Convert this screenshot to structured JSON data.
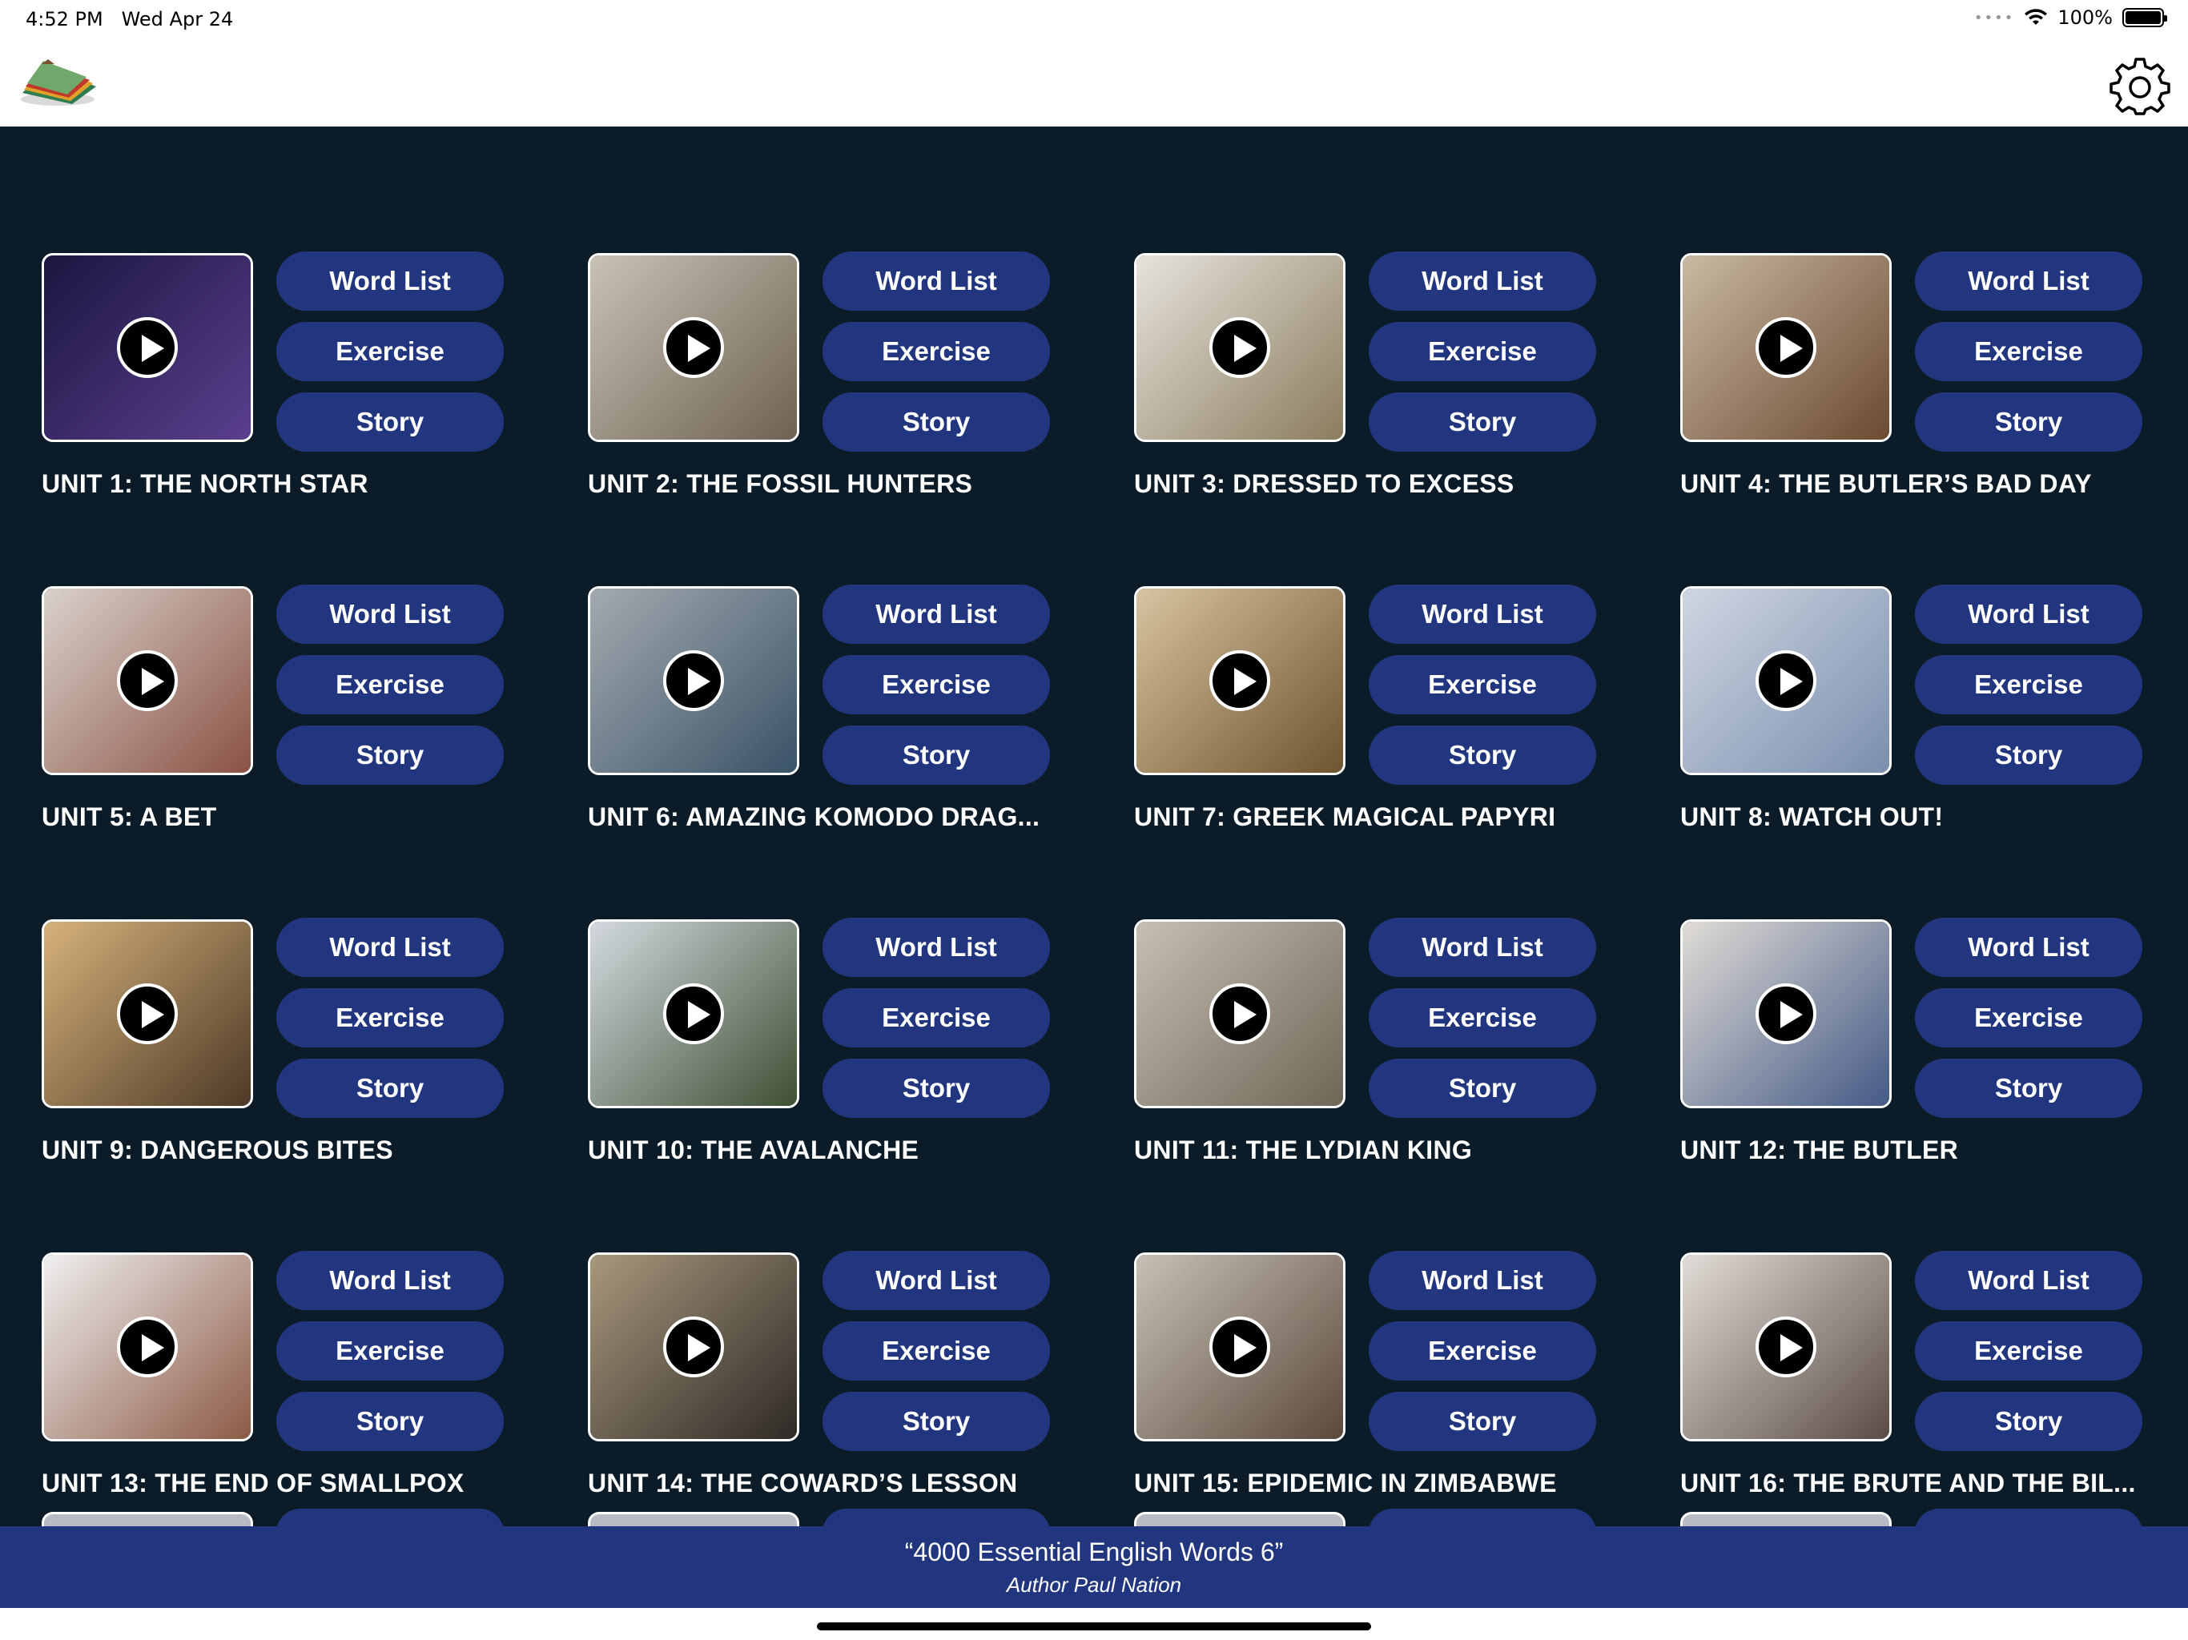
{
  "status": {
    "time": "4:52 PM",
    "date": "Wed Apr 24",
    "battery": "100%"
  },
  "nav": {
    "logo_icon": "flashcards-logo-icon",
    "settings_icon": "gear-icon"
  },
  "buttons": {
    "word_list": "Word List",
    "exercise": "Exercise",
    "story": "Story"
  },
  "units": [
    {
      "title": "UNIT 1: THE NORTH STAR",
      "colors": [
        "#1b1640",
        "#5a3f8e"
      ]
    },
    {
      "title": "UNIT 2: THE FOSSIL HUNTERS",
      "colors": [
        "#c8c2b5",
        "#6e6253"
      ]
    },
    {
      "title": "UNIT 3: DRESSED TO EXCESS",
      "colors": [
        "#e6e3dc",
        "#8b7d5e"
      ]
    },
    {
      "title": "UNIT 4: THE BUTLER’S BAD DAY",
      "colors": [
        "#c9b9a3",
        "#6b4a30"
      ]
    },
    {
      "title": "UNIT 5: A BET",
      "colors": [
        "#d9d2cb",
        "#8a5244"
      ]
    },
    {
      "title": "UNIT 6: AMAZING KOMODO DRAG...",
      "colors": [
        "#a3aab0",
        "#3a5367"
      ]
    },
    {
      "title": "UNIT 7: GREEK MAGICAL PAPYRI",
      "colors": [
        "#d8c4a0",
        "#6f5430"
      ]
    },
    {
      "title": "UNIT 8: WATCH OUT!",
      "colors": [
        "#cfd6e1",
        "#7a8fae"
      ]
    },
    {
      "title": "UNIT 9: DANGEROUS BITES",
      "colors": [
        "#d6b27a",
        "#4d3a26"
      ]
    },
    {
      "title": "UNIT 10: THE AVALANCHE",
      "colors": [
        "#d4dae0",
        "#3f5034"
      ]
    },
    {
      "title": "UNIT 11: THE LYDIAN KING",
      "colors": [
        "#c6bfb2",
        "#6f6657"
      ]
    },
    {
      "title": "UNIT 12: THE BUTLER",
      "colors": [
        "#e0dcd5",
        "#445a86"
      ]
    },
    {
      "title": "UNIT 13: THE END OF SMALLPOX",
      "colors": [
        "#efefef",
        "#8c5a45"
      ]
    },
    {
      "title": "UNIT 14: THE COWARD’S LESSON",
      "colors": [
        "#a8987c",
        "#2e2a26"
      ]
    },
    {
      "title": "UNIT 15: EPIDEMIC IN ZIMBABWE",
      "colors": [
        "#c7c0b5",
        "#5b4a3c"
      ]
    },
    {
      "title": "UNIT 16: THE BRUTE AND THE BIL...",
      "colors": [
        "#e2ddd8",
        "#5a4b45"
      ]
    }
  ],
  "footer": {
    "book": "“4000 Essential English Words 6”",
    "author": "Author Paul Nation"
  }
}
